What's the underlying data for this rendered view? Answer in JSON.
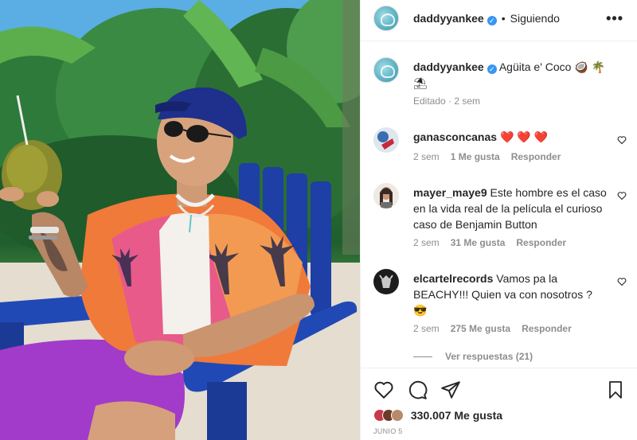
{
  "post": {
    "author": "daddyyankee",
    "follow_state": "Siguiendo",
    "separator": "•",
    "more": "•••",
    "verified_mark": "✓"
  },
  "caption": {
    "author": "daddyyankee",
    "text": "Agüita e' Coco 🥥 🌴 ⛱",
    "meta": "Editado · 2 sem"
  },
  "comments": [
    {
      "user": "ganasconcanas",
      "text": "❤️ ❤️ ❤️",
      "time": "2 sem",
      "likes": "1 Me gusta",
      "reply": "Responder"
    },
    {
      "user": "mayer_maye9",
      "text": "Este hombre es el caso en la vida real de la película el curioso caso de Benjamin Button",
      "time": "2 sem",
      "likes": "31 Me gusta",
      "reply": "Responder"
    },
    {
      "user": "elcartelrecords",
      "text": "Vamos pa la BEACHY!!! Quien va con nosotros ? 😎",
      "time": "2 sem",
      "likes": "275 Me gusta",
      "reply": "Responder"
    }
  ],
  "view_replies": "Ver respuestas (21)",
  "footer": {
    "likes": "330.007 Me gusta",
    "date": "JUNIO 5"
  },
  "icons": {
    "like": "heart-icon",
    "comment": "comment-icon",
    "share": "paper-plane-icon",
    "save": "bookmark-icon",
    "more": "more-horizontal-icon"
  },
  "colors": {
    "verified": "#3897f0",
    "text": "#262626",
    "muted": "#8e8e8e",
    "border": "#efefef"
  }
}
